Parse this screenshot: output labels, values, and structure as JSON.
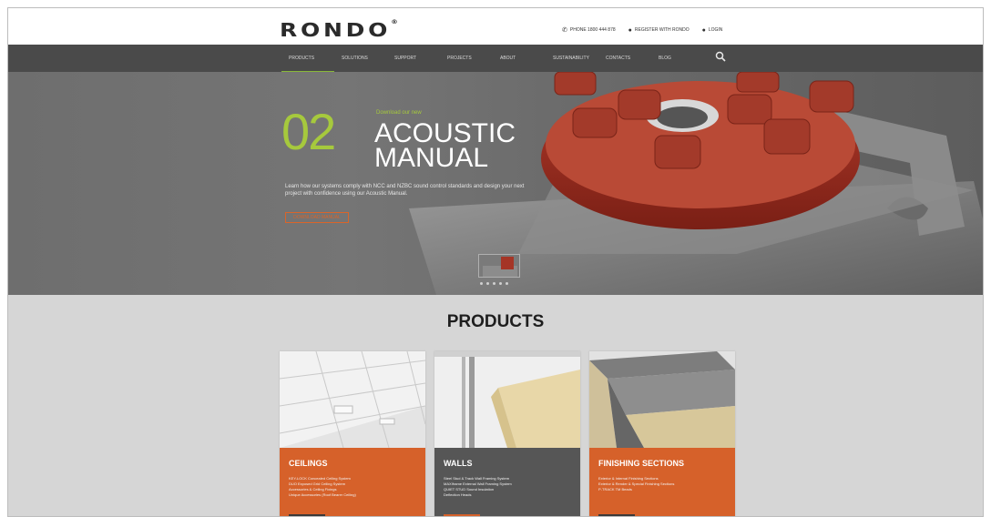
{
  "header": {
    "logo": "RONDO",
    "logo_tm": "®",
    "top_links": [
      {
        "icon": "phone-icon",
        "glyph": "✆",
        "label": "PHONE 1800 444 878"
      },
      {
        "icon": "user-icon",
        "glyph": "👤",
        "label": "REGISTER WITH RONDO"
      },
      {
        "icon": "lock-icon",
        "glyph": "●",
        "label": "LOGIN"
      }
    ]
  },
  "nav": {
    "items": [
      "PRODUCTS",
      "SOLUTIONS",
      "SUPPORT",
      "PROJECTS",
      "ABOUT",
      "SUSTAINABILITY",
      "CONTACTS",
      "BLOG"
    ],
    "search_glyph": "⚲"
  },
  "hero": {
    "number": "02",
    "kicker": "Download our new",
    "title": "ACOUSTIC MANUAL",
    "description": "Learn how our systems comply with NCC and NZBC sound control standards and design your next project with confidence using our Acoustic Manual.",
    "button": "DOWNLOAD MANUAL",
    "slides": 5
  },
  "products": {
    "heading": "PRODUCTS",
    "cards": [
      {
        "title": "CEILINGS",
        "style": "orange",
        "items": [
          "KEY-LOCK Concealed Ceiling System",
          "DUO Exposed Grid Ceiling System",
          "Accessories & Ceiling Fixings",
          "Unique Accessories (Roof Bearer Ceiling)"
        ]
      },
      {
        "title": "WALLS",
        "style": "grey",
        "items": [
          "Steel Stud & Track Wall Framing System",
          "MAXIframe External Wall Framing System",
          "QUIET STUD Sound Insulation",
          "Deflection Heads"
        ]
      },
      {
        "title": "FINISHING SECTIONS",
        "style": "orange",
        "items": [
          "Exterior & Internal Finishing Sections",
          "Exterior & Render & Special Finishing Sections",
          "P-TRACK TM Beads"
        ]
      }
    ]
  },
  "colors": {
    "accent_green": "#a6c93d",
    "accent_orange": "#d6612a",
    "nav_bg": "#4a4a4a"
  }
}
